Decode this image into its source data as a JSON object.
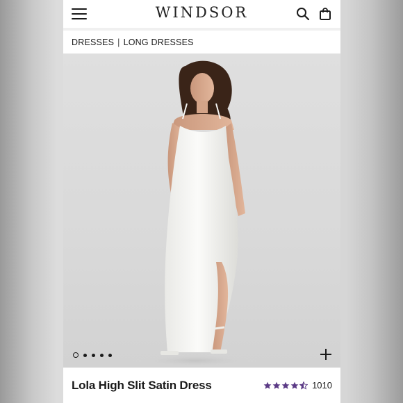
{
  "header": {
    "logo": "WINDSOR",
    "icons": [
      "menu-icon",
      "search-icon",
      "bag-icon"
    ]
  },
  "breadcrumb": {
    "items": [
      "DRESSES",
      "LONG DRESSES"
    ],
    "separator": "|"
  },
  "gallery": {
    "image_count": 5,
    "active_index": 0,
    "zoom_icon": "plus-icon"
  },
  "product": {
    "title": "Lola High Slit Satin Dress",
    "rating": 4.5,
    "rating_max": 5,
    "review_count": "1010"
  },
  "colors": {
    "star": "#5b3a86",
    "text": "#1a1a1a"
  }
}
